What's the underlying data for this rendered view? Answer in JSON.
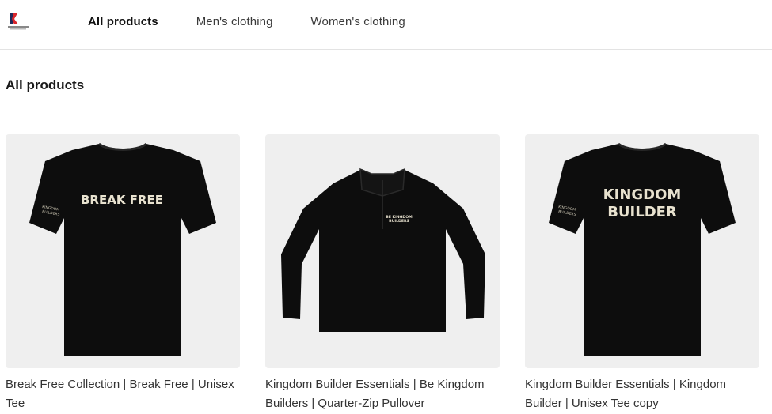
{
  "nav": {
    "items": [
      {
        "label": "All products",
        "active": true
      },
      {
        "label": "Men's clothing",
        "active": false
      },
      {
        "label": "Women's clothing",
        "active": false
      }
    ]
  },
  "page": {
    "title": "All products"
  },
  "products": [
    {
      "title": "Break Free Collection | Break Free | Unisex Tee",
      "print_text": [
        "BREAK FREE"
      ],
      "sleeve_text": [
        "KINGDOM",
        "BUILDERS"
      ],
      "garment": "tee"
    },
    {
      "title": "Kingdom Builder Essentials | Be Kingdom Builders | Quarter-Zip Pullover",
      "print_text": [
        "BE KINGDOM",
        "BUILDERS"
      ],
      "garment": "quarter-zip"
    },
    {
      "title": "Kingdom Builder Essentials | Kingdom Builder | Unisex Tee copy",
      "print_text": [
        "KINGDOM",
        "BUILDER"
      ],
      "sleeve_text": [
        "KINGDOM",
        "BUILDERS"
      ],
      "garment": "tee"
    }
  ],
  "colors": {
    "garment": "#0d0d0d",
    "print": "#e8e2cf",
    "thumb_bg": "#efefef",
    "logo_red": "#d9262c",
    "logo_navy": "#1e2a5a"
  }
}
